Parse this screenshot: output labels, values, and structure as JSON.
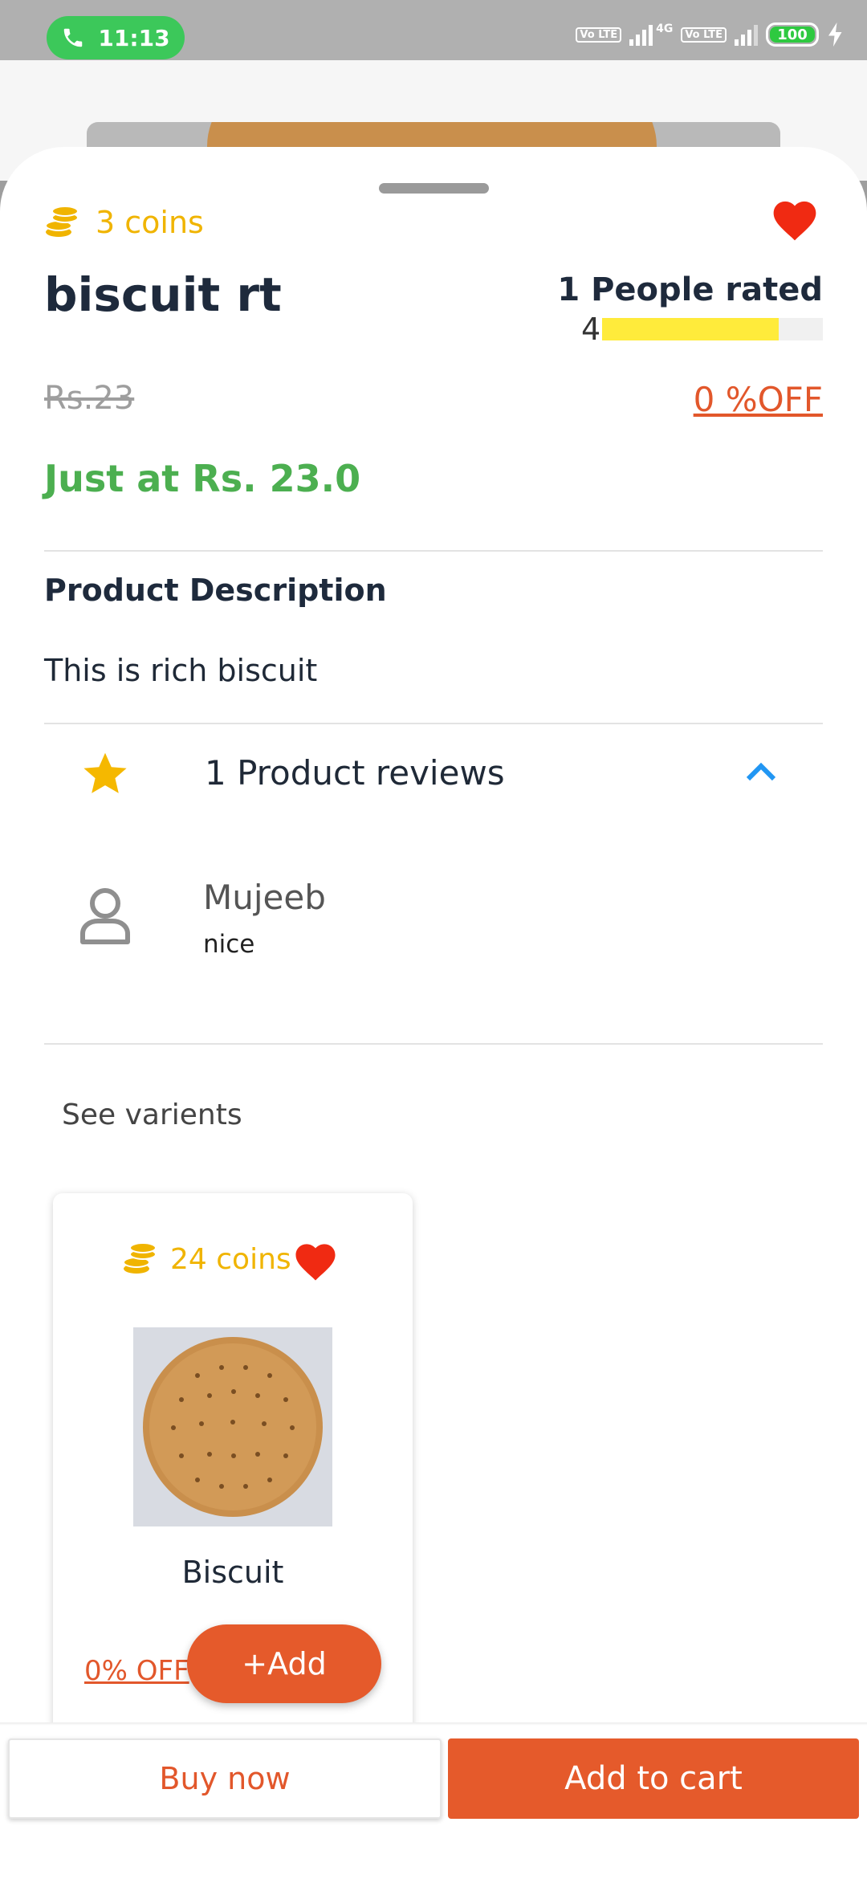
{
  "status_bar": {
    "time": "11:13",
    "network": "4G",
    "volte_label": "Vo LTE",
    "battery": "100"
  },
  "product": {
    "coins": "3 coins",
    "title": "biscuit rt",
    "people_rated": "1 People rated",
    "rating_value": "4",
    "rating_fraction": 0.8,
    "old_price": "Rs.23",
    "discount": "0 %OFF",
    "final_price": "Just at Rs. 23.0",
    "description_title": "Product Description",
    "description": "This is rich biscuit",
    "favorite": true
  },
  "reviews": {
    "summary": "1 Product reviews",
    "expanded": true,
    "items": [
      {
        "name": "Mujeeb",
        "text": "nice"
      }
    ]
  },
  "variants": {
    "heading": "See varients",
    "items": [
      {
        "coins": "24 coins",
        "name": "Biscuit",
        "discount": "0% OFF",
        "add_label": "+Add"
      }
    ]
  },
  "actions": {
    "buy_now": "Buy now",
    "add_to_cart": "Add to cart"
  },
  "colors": {
    "accent": "#e55a2b",
    "coins": "#f0b400",
    "price_green": "#4caf50",
    "heart": "#f02a12",
    "rating_bar": "#ffeb3b",
    "chevron": "#2196f3"
  }
}
